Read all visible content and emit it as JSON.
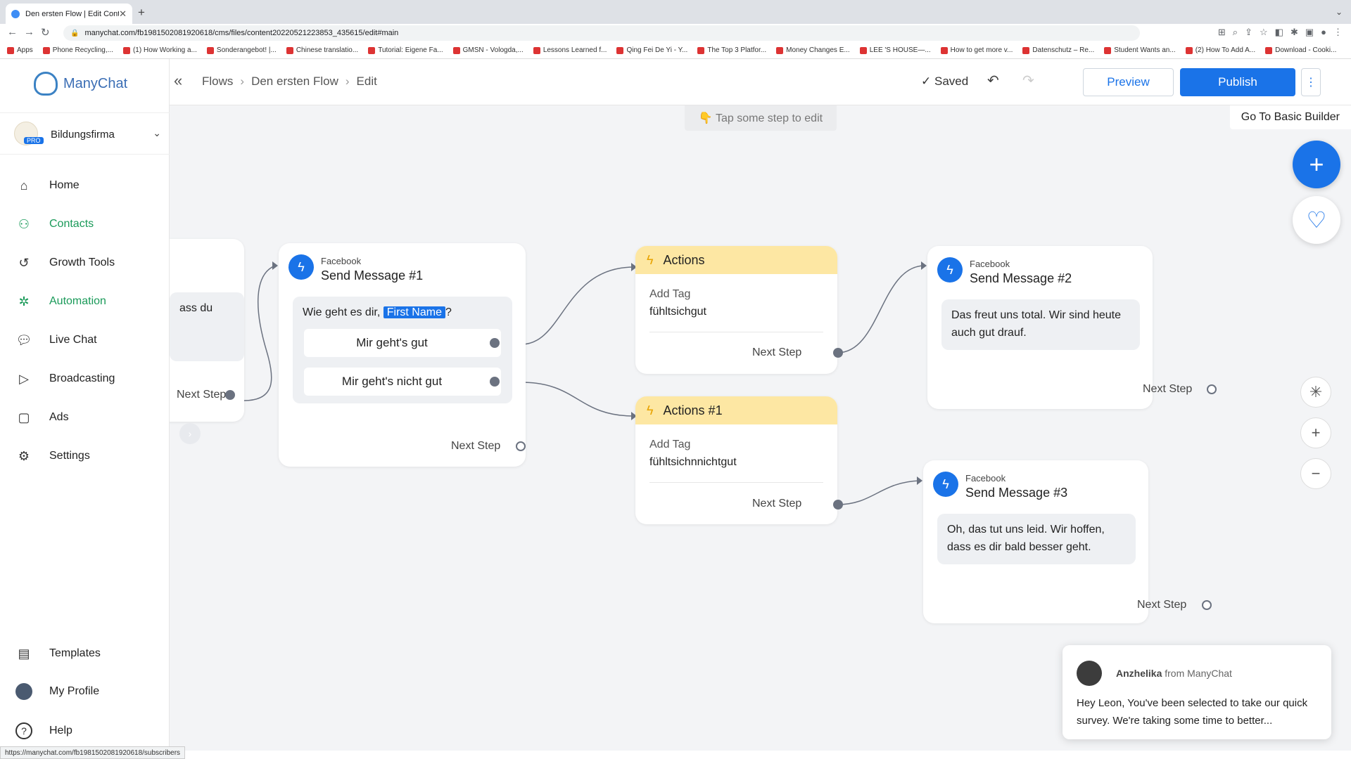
{
  "browser": {
    "tab_title": "Den ersten Flow | Edit Content",
    "url": "manychat.com/fb198150208192061​8/cms/files/content20220521223853_435615/edit#main",
    "bookmarks": [
      "Apps",
      "Phone Recycling,...",
      "(1) How Working a...",
      "Sonderangebot! |...",
      "Chinese translatio...",
      "Tutorial: Eigene Fa...",
      "GMSN - Vologda,...",
      "Lessons Learned f...",
      "Qing Fei De Yi - Y...",
      "The Top 3 Platfor...",
      "Money Changes E...",
      "LEE 'S HOUSE—...",
      "How to get more v...",
      "Datenschutz – Re...",
      "Student Wants an...",
      "(2) How To Add A...",
      "Download - Cooki..."
    ],
    "status_url": "https://manychat.com/fb198150208192061​8/subscribers"
  },
  "sidebar": {
    "brand": "ManyChat",
    "account": "Bildungsfirma",
    "pro_badge": "PRO",
    "items": [
      {
        "label": "Home"
      },
      {
        "label": "Contacts"
      },
      {
        "label": "Growth Tools"
      },
      {
        "label": "Automation"
      },
      {
        "label": "Live Chat"
      },
      {
        "label": "Broadcasting"
      },
      {
        "label": "Ads"
      },
      {
        "label": "Settings"
      }
    ],
    "bottom": [
      {
        "label": "Templates"
      },
      {
        "label": "My Profile"
      },
      {
        "label": "Help"
      }
    ]
  },
  "header": {
    "breadcrumbs": [
      "Flows",
      "Den ersten Flow",
      "Edit"
    ],
    "saved": "Saved",
    "preview": "Preview",
    "publish": "Publish"
  },
  "canvas": {
    "hint": "👇 Tap some step to edit",
    "basic_builder": "Go To Basic Builder",
    "partial_card": {
      "text": "ass du",
      "next": "Next Step"
    },
    "msg1": {
      "source": "Facebook",
      "title": "Send Message #1",
      "text_before": "Wie geht es dir,",
      "variable": "First Name",
      "text_after": "?",
      "button1": "Mir geht's gut",
      "button2": "Mir geht's nicht gut",
      "next": "Next Step"
    },
    "actions": {
      "title": "Actions",
      "label": "Add Tag",
      "value": "fühltsichgut",
      "next": "Next Step"
    },
    "actions1": {
      "title": "Actions #1",
      "label": "Add Tag",
      "value": "fühltsichnnichtgut",
      "next": "Next Step"
    },
    "msg2": {
      "source": "Facebook",
      "title": "Send Message #2",
      "text": "Das freut uns total. Wir sind heute auch gut drauf.",
      "next": "Next Step"
    },
    "msg3": {
      "source": "Facebook",
      "title": "Send Message #3",
      "text": "Oh, das tut uns leid. Wir hoffen, dass es dir bald besser geht.",
      "next": "Next Step"
    }
  },
  "chat": {
    "agent": "Anzhelika",
    "from": "from ManyChat",
    "message": "Hey Leon,  You've been selected to take our quick survey. We're taking some time to better..."
  },
  "colors": {
    "accent": "#1a73e8",
    "automation": "#1a9a59",
    "action_header": "#fde7a3"
  }
}
